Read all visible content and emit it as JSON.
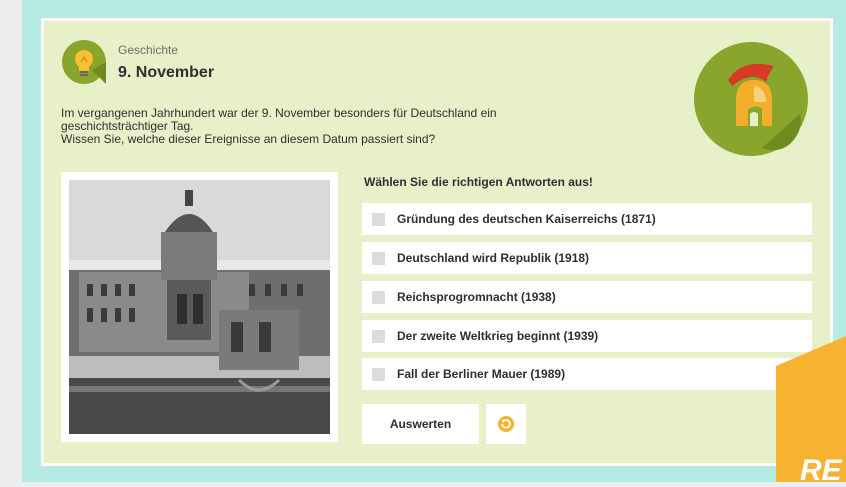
{
  "category": {
    "label": "Geschichte",
    "icon": "lightbulb-icon"
  },
  "quiz": {
    "title": "9. November",
    "intro_line1": "Im vergangenen Jahrhundert war der 9. November besonders für Deutschland ein",
    "intro_line2": "geschichtsträchtiger Tag.",
    "intro_line3": "Wissen Sie, welche dieser Ereignisse an diesem Datum passiert sind?",
    "instruction": "Wählen Sie die richtigen Antworten aus!",
    "options": [
      {
        "label": "Gründung des deutschen Kaiserreichs (1871)",
        "checked": false
      },
      {
        "label": "Deutschland wird Republik (1918)",
        "checked": false
      },
      {
        "label": "Reichsprogromnacht (1938)",
        "checked": false
      },
      {
        "label": "Der zweite Weltkrieg beginnt (1939)",
        "checked": false
      },
      {
        "label": "Fall der Berliner Mauer (1989)",
        "checked": false
      }
    ],
    "evaluate_label": "Auswerten",
    "reset_icon": "reset-icon"
  },
  "topic_icon": "helmet-icon",
  "badge_text": "RE",
  "colors": {
    "panel_bg": "#e7f0c9",
    "frame_bg": "#b6ebe3",
    "accent_orange": "#f7b232",
    "green": "#8aa52c"
  }
}
